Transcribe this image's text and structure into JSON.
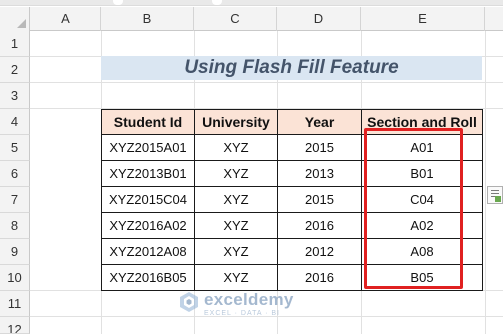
{
  "sheet": {
    "columns": [
      "A",
      "B",
      "C",
      "D",
      "E"
    ],
    "rows": [
      "1",
      "2",
      "3",
      "4",
      "5",
      "6",
      "7",
      "8",
      "9",
      "10",
      "11",
      "12"
    ]
  },
  "title": "Using Flash Fill Feature",
  "table": {
    "headers": [
      "Student Id",
      "University",
      "Year",
      "Section and Roll"
    ],
    "rows": [
      [
        "XYZ2015A01",
        "XYZ",
        "2015",
        "A01"
      ],
      [
        "XYZ2013B01",
        "XYZ",
        "2013",
        "B01"
      ],
      [
        "XYZ2015C04",
        "XYZ",
        "2015",
        "C04"
      ],
      [
        "XYZ2016A02",
        "XYZ",
        "2016",
        "A02"
      ],
      [
        "XYZ2012A08",
        "XYZ",
        "2012",
        "A08"
      ],
      [
        "XYZ2016B05",
        "XYZ",
        "2016",
        "B05"
      ]
    ]
  },
  "watermark": {
    "name": "exceldemy",
    "tagline": "EXCEL · DATA · BI"
  },
  "colors": {
    "title_bg": "#dae6f2",
    "title_text": "#44546a",
    "header_bg": "#fbe3d6",
    "highlight": "#e02020"
  },
  "icons": {
    "flash_fill_options": "flash-fill-options-icon",
    "select_all": "select-all-triangle-icon",
    "watermark_logo": "exceldemy-logo-icon"
  }
}
